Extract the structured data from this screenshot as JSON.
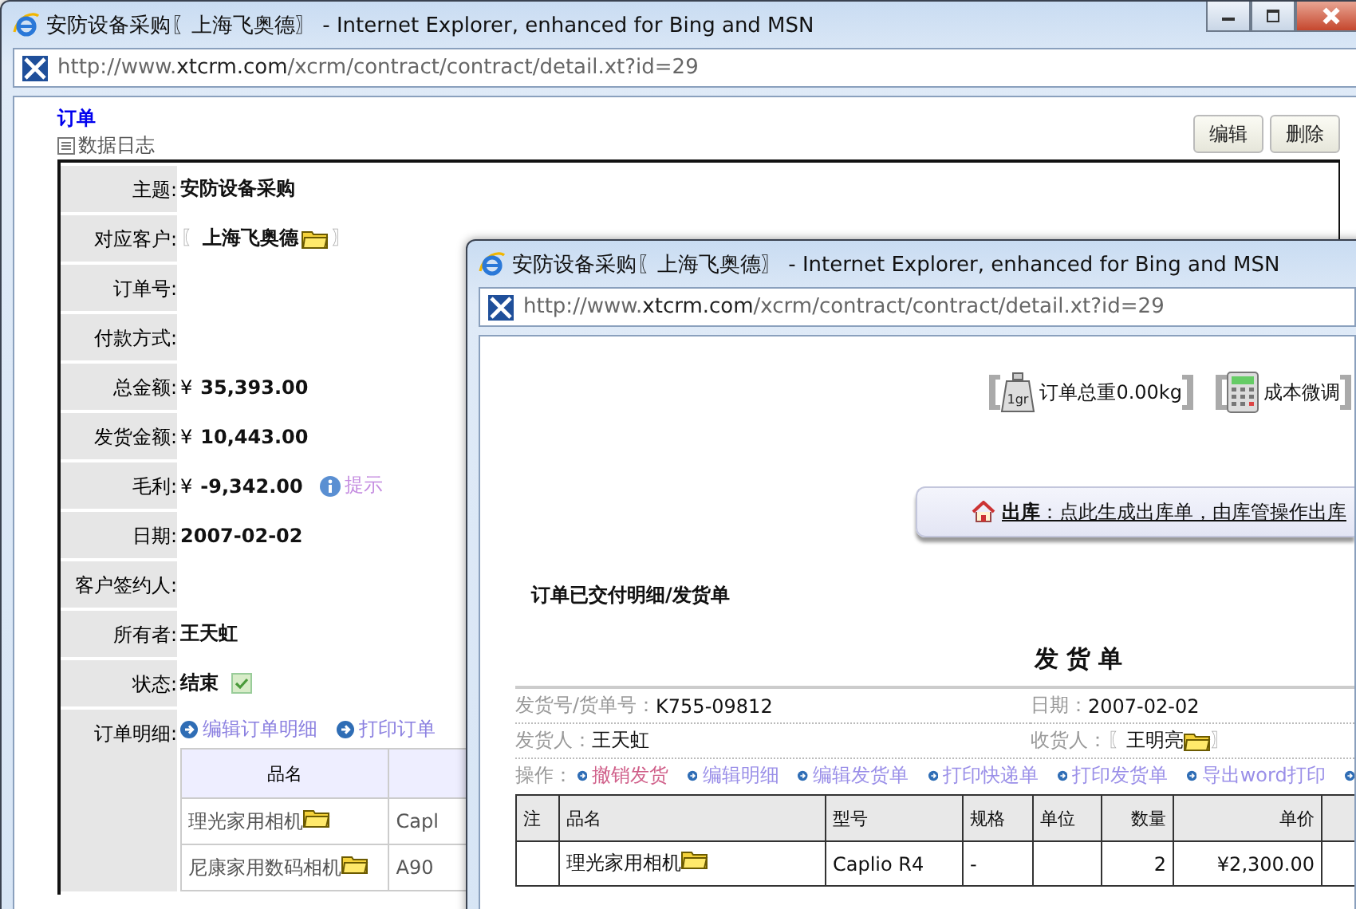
{
  "back_window": {
    "title": "安防设备采购〖上海飞奥德〗 - Internet Explorer, enhanced for Bing and MSN",
    "url": "http://www.xtcrm.com/xcrm/contract/contract/detail.xt?id=29",
    "page_title": "订单",
    "log_link": "数据日志",
    "buttons": [
      "编辑",
      "删除"
    ],
    "fields": [
      {
        "kind": "text",
        "label": "主题:",
        "value": "安防设备采购"
      },
      {
        "kind": "ref",
        "label": "对应客户:",
        "value": "上海飞奥德",
        "open": "〖",
        "close": "〗"
      },
      {
        "kind": "text",
        "label": "订单号:"
      },
      {
        "kind": "text",
        "label": "付款方式:"
      },
      {
        "kind": "money",
        "label": "总金额:",
        "currency": "¥",
        "value": "35,393.00"
      },
      {
        "kind": "money",
        "label": "发货金额:",
        "currency": "¥",
        "value": "10,443.00"
      },
      {
        "kind": "money",
        "label": "毛利:",
        "currency": "¥",
        "value": "-9,342.00",
        "hint": "提示"
      },
      {
        "kind": "text",
        "label": "日期:",
        "value": "2007-02-02"
      },
      {
        "kind": "text",
        "label": "客户签约人:"
      },
      {
        "kind": "text",
        "label": "所有者:",
        "value": "王天虹"
      },
      {
        "kind": "status",
        "label": "状态:",
        "value": "结束",
        "checked": true
      },
      {
        "kind": "items",
        "label": "订单明细:",
        "links": [
          "编辑订单明细",
          "打印订单"
        ],
        "columns": [
          "品名"
        ],
        "rows": [
          [
            "理光家用相机",
            "Capl"
          ],
          [
            "尼康家用数码相机",
            "A90"
          ]
        ]
      }
    ]
  },
  "front_window": {
    "title": "安防设备采购〖上海飞奥德〗 - Internet Explorer, enhanced for Bing and MSN",
    "url": "http://www.xtcrm.com/xcrm/contract/contract/detail.xt?id=29",
    "weight": {
      "icon_label": "1gr",
      "text": "订单总重0.00kg"
    },
    "cost": "成本微调",
    "outbound": "**出库**：点此生成出库单，由库管操作出库",
    "section_title": "订单已交付明细/发货单",
    "doc_title": "发 货 单",
    "info": [
      {
        "label": "发货号/货单号：",
        "value": "K755-09812"
      },
      {
        "label": "日期：",
        "value": "2007-02-02"
      },
      {
        "label": "发货人：",
        "value": "王天虹"
      },
      {
        "label": "收货人：",
        "value": "王明亮",
        "kind": "ref",
        "open": "〖",
        "close": "〗"
      }
    ],
    "ops_label": "操作：",
    "ops": [
      {
        "label": "撤销发货",
        "kind": "danger"
      },
      {
        "label": "编辑明细",
        "kind": "normal"
      },
      {
        "label": "编辑发货单",
        "kind": "normal"
      },
      {
        "label": "打印快递单",
        "kind": "normal"
      },
      {
        "label": "打印发货单",
        "kind": "normal"
      },
      {
        "label": "导出word打印",
        "kind": "normal"
      }
    ],
    "columns": [
      "注",
      "品名",
      "型号",
      "规格",
      "单位",
      "数量",
      "单价"
    ],
    "rows": [
      [
        null,
        "理光家用相机",
        "Caplio R4",
        "-",
        null,
        "2",
        "¥2,300.00"
      ]
    ]
  }
}
